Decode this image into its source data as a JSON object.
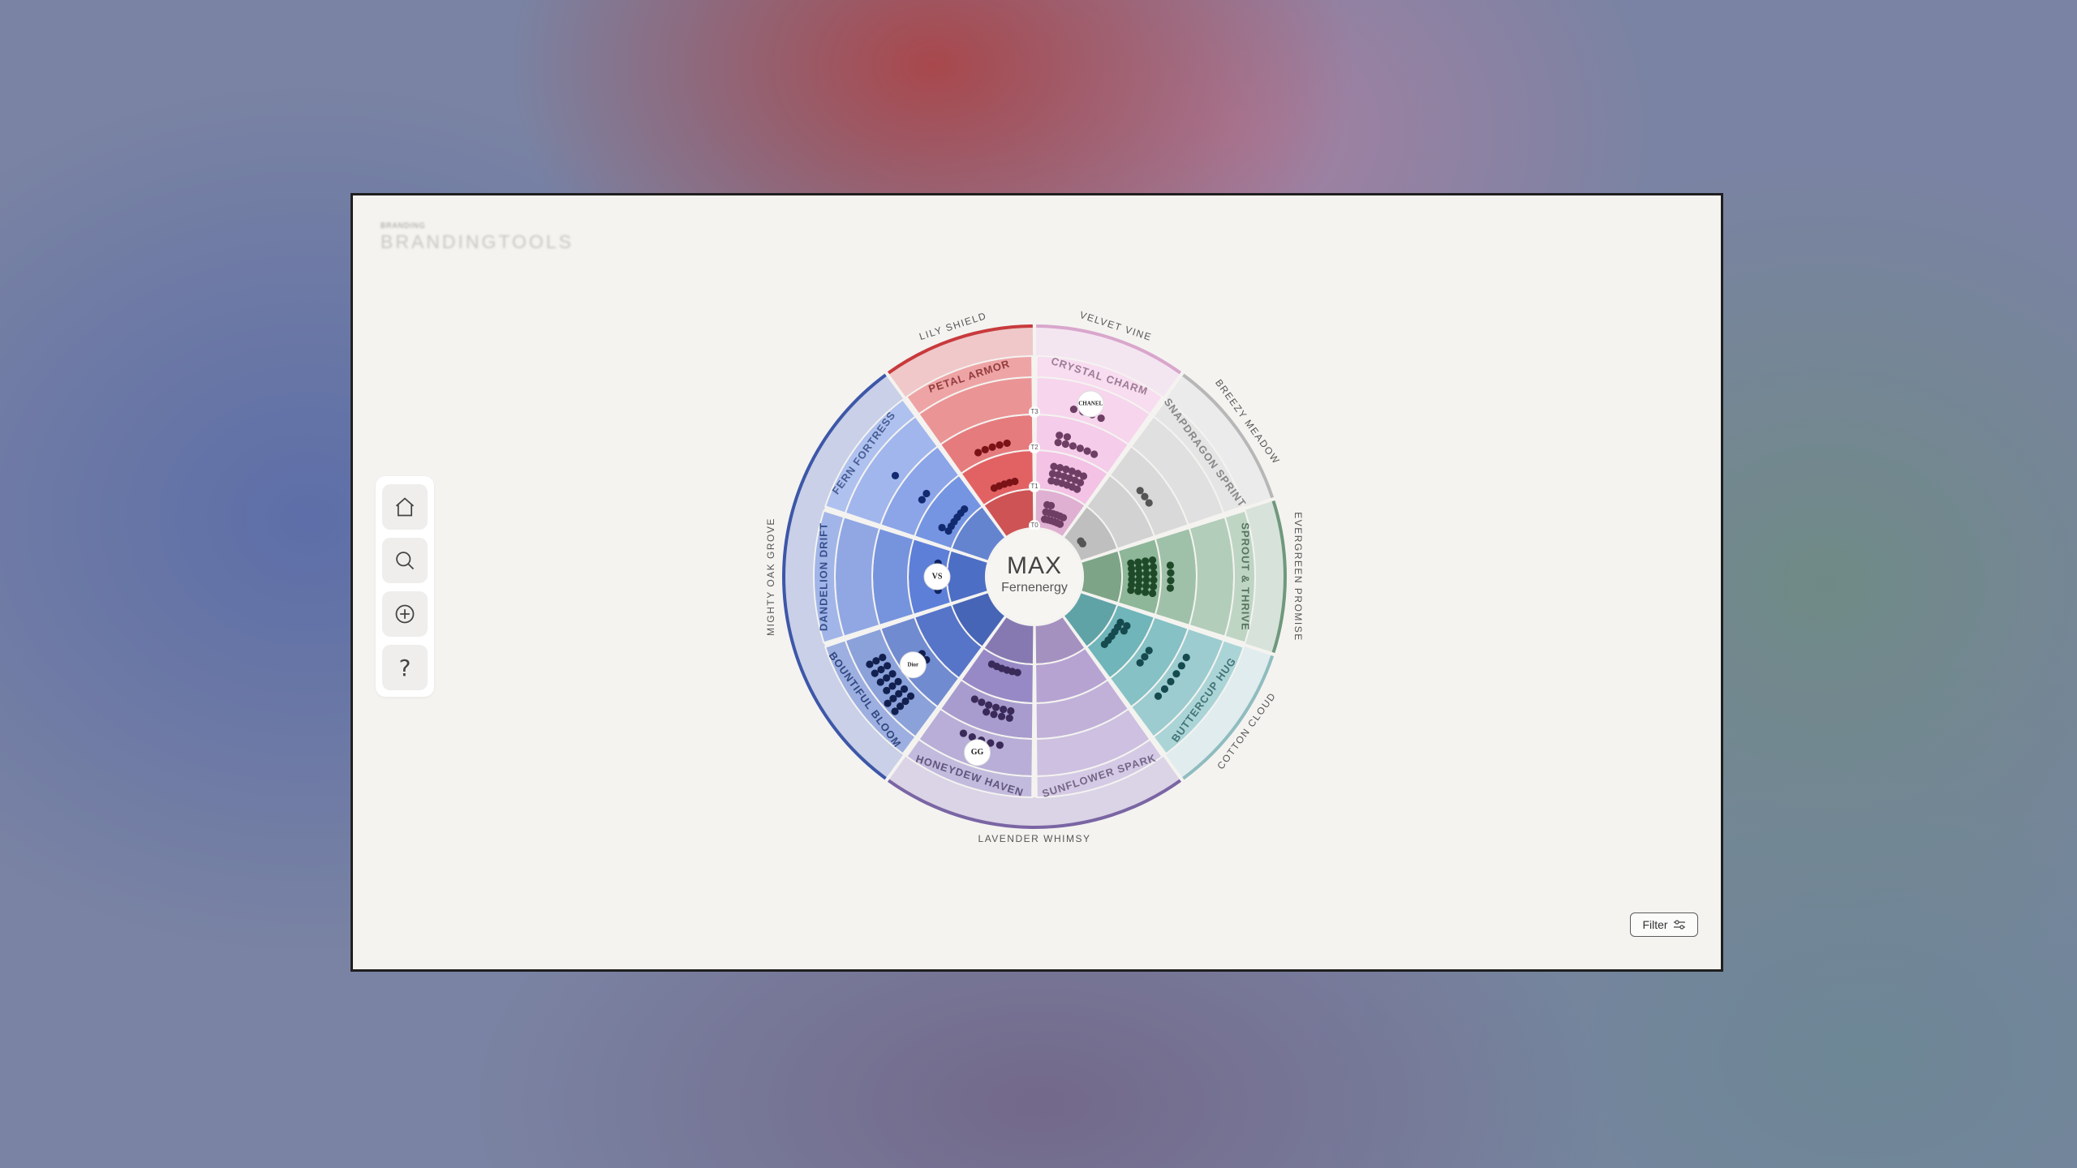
{
  "brand": {
    "small": "BRANDING",
    "name": "BRANDINGTOOLS"
  },
  "toolbar": [
    {
      "icon": "home-icon"
    },
    {
      "icon": "search-icon"
    },
    {
      "icon": "add-circle-icon"
    },
    {
      "icon": "help-icon",
      "glyph": "?"
    }
  ],
  "center": {
    "title": "MAX",
    "subtitle": "Fernenergy"
  },
  "filter": {
    "label": "Filter"
  },
  "colors": {
    "frame_bg": "#f4f3f0",
    "border": "#1f1f1f"
  },
  "groups": [
    {
      "name": "LILY SHIELD",
      "color": "#c83a3d"
    },
    {
      "name": "VELVET VINE",
      "color": "#d9a6cc"
    },
    {
      "name": "BREEZY MEADOW",
      "color": "#b7b7b7"
    },
    {
      "name": "EVERGREEN PROMISE",
      "color": "#6f987c"
    },
    {
      "name": "COTTON CLOUD",
      "color": "#8fbcbf"
    },
    {
      "name": "LAVENDER WHIMSY",
      "color": "#7a65a4"
    },
    {
      "name": "MIGHTY OAK GROVE",
      "color": "#3d57a8"
    }
  ],
  "segments": [
    {
      "name": "PETAL ARMOR",
      "color": "#e05a5c",
      "dot": "#7a1216",
      "dots": [
        0,
        5,
        5,
        0
      ]
    },
    {
      "name": "CRYSTAL CHARM",
      "color": "#f2bfe4",
      "dot": "#6e3e64",
      "dots": [
        14,
        18,
        8,
        4
      ]
    },
    {
      "name": "SNAPDRAGON SPRINT",
      "color": "#d0d0d0",
      "dot": "#555555",
      "dots": [
        2,
        0,
        3,
        0
      ]
    },
    {
      "name": "SPROUT & THRIVE",
      "color": "#88b293",
      "dot": "#1e4a2a",
      "dots": [
        0,
        24,
        4,
        0
      ]
    },
    {
      "name": "BUTTERCUP HUG",
      "color": "#67b1b6",
      "dot": "#154a4e",
      "dots": [
        0,
        8,
        3,
        6
      ]
    },
    {
      "name": "SUNFLOWER SPARK",
      "color": "#b29ed0",
      "dot": "#3d2c5a",
      "dots": [
        0,
        0,
        0,
        0
      ]
    },
    {
      "name": "HONEYDEW HAVEN",
      "color": "#9283c2",
      "dot": "#3a2a5a",
      "dots": [
        0,
        6,
        10,
        5
      ]
    },
    {
      "name": "BOUNTIFUL BLOOM",
      "color": "#4d6ec6",
      "dot": "#122050",
      "dots": [
        0,
        0,
        2,
        20
      ]
    },
    {
      "name": "DANDELION DRIFT",
      "color": "#5478d6",
      "dot": "#0f2460",
      "dots": [
        0,
        6,
        0,
        0
      ]
    },
    {
      "name": "FERN FORTRESS",
      "color": "#6e8fe2",
      "dot": "#122a70",
      "dots": [
        0,
        7,
        2,
        1
      ]
    }
  ],
  "ring_labels": [
    "T0",
    "T1",
    "T2",
    "T3"
  ],
  "badges": [
    {
      "label": "CHANEL",
      "segment": 1
    },
    {
      "label": "Dior",
      "segment": 7
    },
    {
      "label": "VS",
      "segment": 8
    },
    {
      "label": "GG",
      "segment": 6
    }
  ]
}
